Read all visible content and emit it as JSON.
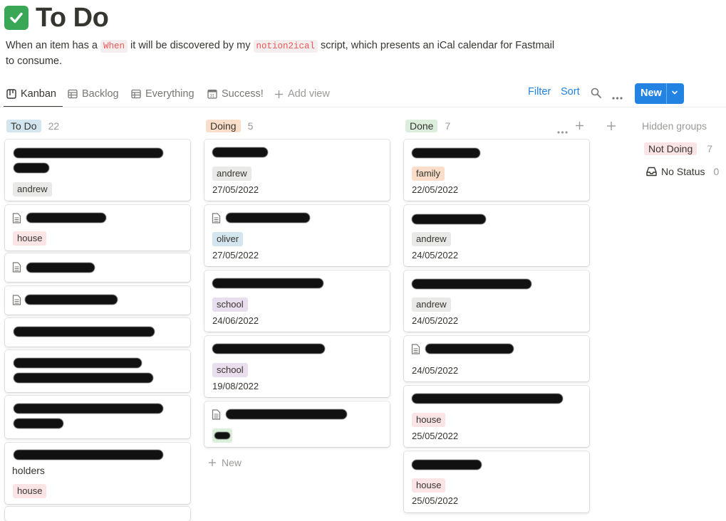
{
  "page": {
    "title": "To Do",
    "desc_part1": "When an item has a ",
    "desc_code1": "When",
    "desc_part2": " it will be discovered by my ",
    "desc_code2": "notion2ical",
    "desc_part3": " script, which presents an iCal calendar for Fastmail to consume."
  },
  "views": {
    "tabs": [
      {
        "label": "Kanban",
        "icon": "board-icon"
      },
      {
        "label": "Backlog",
        "icon": "table-icon"
      },
      {
        "label": "Everything",
        "icon": "table-icon"
      },
      {
        "label": "Success!",
        "icon": "calendar-icon"
      }
    ],
    "add_view": "Add view",
    "filter": "Filter",
    "sort": "Sort",
    "new_label": "New"
  },
  "colors": {
    "accent": "#2383e2",
    "check": "#3aa757",
    "tag_gray": "#e9e9e7",
    "tag_red": "#fbe4e4",
    "tag_blue": "#d3e5ef",
    "tag_purple": "#e8deee",
    "tag_orange": "#fadec9",
    "tag_green": "#dbeddb"
  },
  "board": {
    "columns": [
      {
        "name": "To Do",
        "count": "22",
        "color": "#d3e5ef",
        "cards": [
          {
            "tag": "andrew"
          },
          {
            "tag": "house"
          },
          {},
          {},
          {},
          {},
          {},
          {
            "partial_text": "holders",
            "tag": "house"
          }
        ]
      },
      {
        "name": "Doing",
        "count": "5",
        "color": "#fadec9",
        "cards": [
          {
            "tag": "andrew",
            "date": "27/05/2022"
          },
          {
            "tag": "oliver",
            "date": "27/05/2022"
          },
          {
            "tag": "school",
            "date": "24/06/2022"
          },
          {
            "tag": "school",
            "date": "19/08/2022"
          },
          {}
        ],
        "add_new": "New"
      },
      {
        "name": "Done",
        "count": "7",
        "color": "#dbeddb",
        "cards": [
          {
            "tag": "family",
            "date": "22/05/2022"
          },
          {
            "tag": "andrew",
            "date": "24/05/2022"
          },
          {
            "tag": "andrew",
            "date": "24/05/2022"
          },
          {
            "date": "24/05/2022"
          },
          {
            "tag": "house",
            "date": "25/05/2022"
          },
          {
            "tag": "house",
            "date": "25/05/2022"
          }
        ]
      }
    ],
    "hidden_groups": {
      "title": "Hidden groups",
      "items": [
        {
          "label": "Not Doing",
          "count": "7"
        },
        {
          "label": "No Status",
          "count": "0"
        }
      ]
    }
  }
}
